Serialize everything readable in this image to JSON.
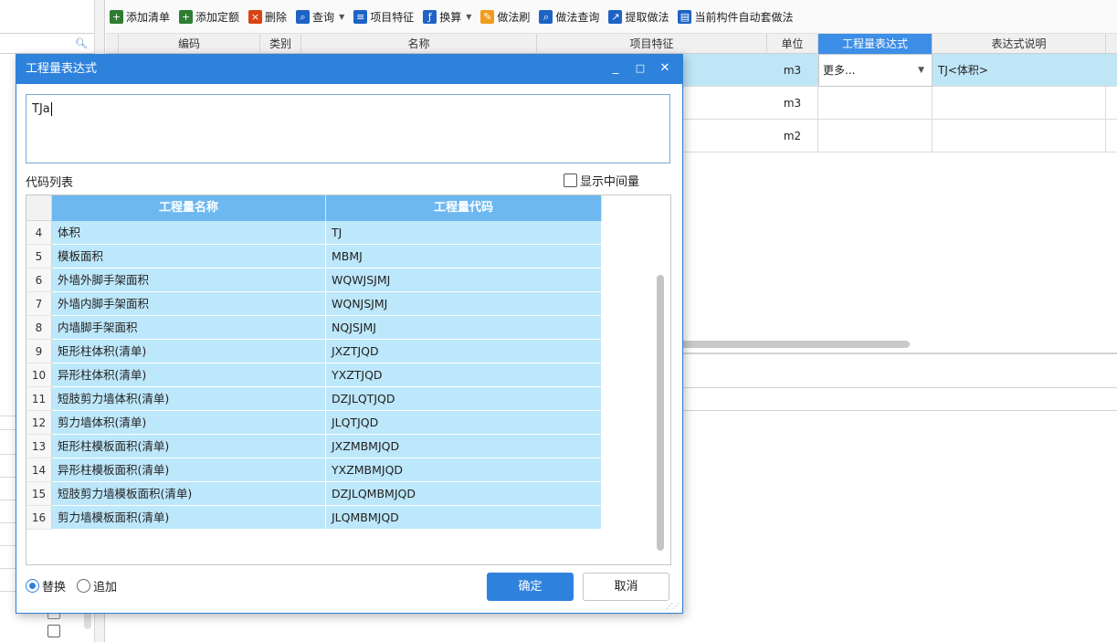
{
  "toolbar": {
    "items": [
      {
        "label": "添加清单",
        "icon": "add-list-icon",
        "color": "#2e7d32"
      },
      {
        "label": "添加定额",
        "icon": "add-quota-icon",
        "color": "#2e7d32"
      },
      {
        "label": "删除",
        "icon": "delete-icon",
        "color": "#d84315"
      },
      {
        "label": "查询",
        "icon": "query-icon",
        "color": "#1e63c4",
        "dropdown": true
      },
      {
        "label": "项目特征",
        "icon": "feature-icon",
        "color": "#1e63c4"
      },
      {
        "label": "换算",
        "icon": "fx-icon",
        "color": "#1e63c4",
        "dropdown": true
      },
      {
        "label": "做法刷",
        "icon": "brush-icon",
        "color": "#f29b1d"
      },
      {
        "label": "做法查询",
        "icon": "method-query-icon",
        "color": "#1e63c4"
      },
      {
        "label": "提取做法",
        "icon": "extract-icon",
        "color": "#1e63c4"
      },
      {
        "label": "当前构件自动套做法",
        "icon": "auto-apply-icon",
        "color": "#1e63c4"
      }
    ]
  },
  "grid": {
    "headers": [
      "编码",
      "类别",
      "名称",
      "项目特征",
      "单位",
      "工程量表达式",
      "表达式说明"
    ],
    "rows": [
      {
        "unit": "m3",
        "expr": "更多...",
        "desc": "TJ<体积>"
      },
      {
        "unit": "m3",
        "expr": "",
        "desc": ""
      },
      {
        "unit": "m2",
        "expr": "",
        "desc": ""
      }
    ]
  },
  "dialog": {
    "title": "工程量表达式",
    "expression": "TJa",
    "code_list_label": "代码列表",
    "show_intermediate_label": "显示中间量",
    "columns": [
      "工程量名称",
      "工程量代码"
    ],
    "rows": [
      {
        "no": "4",
        "name": "体积",
        "code": "TJ"
      },
      {
        "no": "5",
        "name": "模板面积",
        "code": "MBMJ"
      },
      {
        "no": "6",
        "name": "外墙外脚手架面积",
        "code": "WQWJSJMJ"
      },
      {
        "no": "7",
        "name": "外墙内脚手架面积",
        "code": "WQNJSJMJ"
      },
      {
        "no": "8",
        "name": "内墙脚手架面积",
        "code": "NQJSJMJ"
      },
      {
        "no": "9",
        "name": "矩形柱体积(清单)",
        "code": "JXZTJQD"
      },
      {
        "no": "10",
        "name": "异形柱体积(清单)",
        "code": "YXZTJQD"
      },
      {
        "no": "11",
        "name": "短肢剪力墙体积(清单)",
        "code": "DZJLQTJQD"
      },
      {
        "no": "12",
        "name": "剪力墙体积(清单)",
        "code": "JLQTJQD"
      },
      {
        "no": "13",
        "name": "矩形柱模板面积(清单)",
        "code": "JXZMBMJQD"
      },
      {
        "no": "14",
        "name": "异形柱模板面积(清单)",
        "code": "YXZMBMJQD"
      },
      {
        "no": "15",
        "name": "短肢剪力墙模板面积(清单)",
        "code": "DZJLQMBMJQD"
      },
      {
        "no": "16",
        "name": "剪力墙模板面积(清单)",
        "code": "JLQMBMJQD"
      }
    ],
    "replace_label": "替换",
    "append_label": "追加",
    "ok_label": "确定",
    "cancel_label": "取消",
    "window_buttons": {
      "minimize": "_",
      "maximize": "□",
      "close": "✕"
    }
  }
}
